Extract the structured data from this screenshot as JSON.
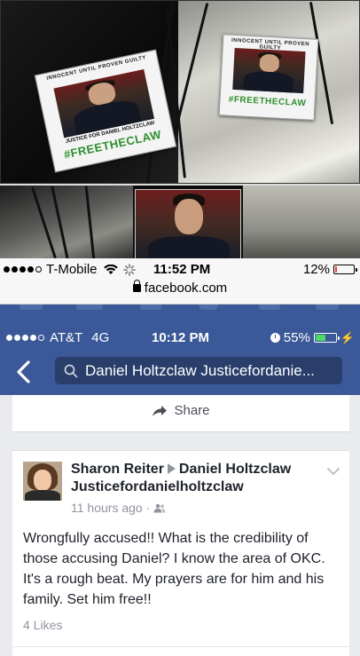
{
  "photos": {
    "card_top_text": "INNOCENT UNTIL PROVEN GUILTY",
    "card_subtitle": "JUSTICE FOR DANIEL HOLTZCLAW",
    "card_hashtag": "#FREETHECLAW"
  },
  "status_bar_1": {
    "carrier": "T-Mobile",
    "time": "11:52 PM",
    "battery": "12%",
    "battery_fill": 0.12,
    "battery_color": "#ff3b30",
    "url": "facebook.com"
  },
  "status_bar_2": {
    "carrier": "AT&T",
    "network": "4G",
    "time": "10:12 PM",
    "battery": "55%",
    "battery_fill": 0.55,
    "battery_color": "#4cd964"
  },
  "nav": {
    "search_text": "Daniel Holtzclaw Justicefordanie...",
    "icons": [
      "back-arrow-icon",
      "search-icon"
    ]
  },
  "share": {
    "label": "Share"
  },
  "post": {
    "author": "Sharon Reiter",
    "target": "Daniel Holtzclaw",
    "target_line2": "Justicefordanielholtzclaw",
    "time": "11 hours ago",
    "audience_icon": "friends-icon",
    "text": "Wrongfully accused!! What is the credibility of those accusing Daniel? I know the area of OKC. It's a rough beat. My prayers are for him and his family. Set him free!!",
    "likes": "4 Likes"
  },
  "colors": {
    "facebook_blue": "#3b5998",
    "search_bg": "#293e6a"
  }
}
